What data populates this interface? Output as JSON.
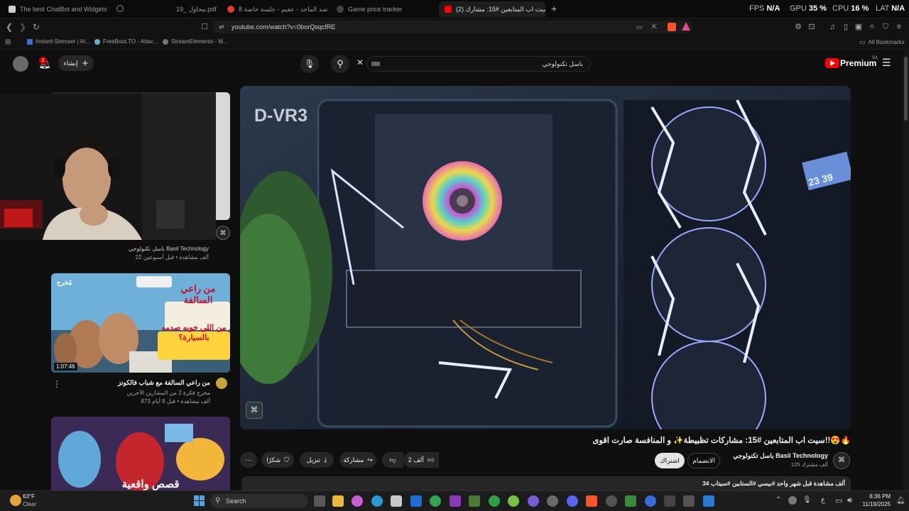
{
  "tabs": [
    {
      "label": "The best ChatBot and Widgets for K",
      "color": "#cfcfcf"
    },
    {
      "label": "19_ محاول.pdf",
      "color": "#8e8e8e"
    },
    {
      "label": "راشد الماجد - عقيم - جلسة خاصة 8",
      "color": "#e53935"
    },
    {
      "label": "Game price tracker",
      "color": "#444444"
    },
    {
      "label": "(2) سيت اب المتابعين #15: مشارك",
      "color": "#ff0000"
    }
  ],
  "stats": {
    "fps_label": "FPS",
    "fps": "N/A",
    "gpu_label": "GPU",
    "gpu": "35 %",
    "cpu_label": "CPU",
    "cpu": "16 %",
    "lat_label": "LAT",
    "lat": "N/A"
  },
  "url": "youtube.com/watch?v=0borQsqcfRE",
  "bookmarks": [
    {
      "label": "Instant-Stresser | At..."
    },
    {
      "label": "FreeBoot.TO - Attac..."
    },
    {
      "label": "StreamElements - M..."
    }
  ],
  "all_bookmarks": "All Bookmarks",
  "youtube": {
    "create_label": "إنشاء",
    "notif_count": "2",
    "search_value": "باسل تكنولوجي",
    "logo": "Premium",
    "logo_sup": "SA"
  },
  "player": {
    "overlay_text": "D-VR3",
    "display_digits": "23 39"
  },
  "video": {
    "title": "سيت اب المتابعين #15: مشاركات تظبيطة✨ و المنافسة صارت اقوى!!😍🔥",
    "channel": "باسل تكنولوجي Basil Technology",
    "subs": "125 ألف مشترك",
    "join": "الانضمام",
    "subscribe": "اشتراك",
    "likes": "2 ألف",
    "share": "مشاركة",
    "download": "تنزيل",
    "thanks": "شكرًا",
    "desc_line": "34 ألف مشاهدة قبل شهر واحد #بيسي #الستابين #سيتاب"
  },
  "recs": [
    {
      "channel": "باسل تكنولوجي Basil Technology",
      "meta": "22 ألف مشاهدة • قبل أسبوعين"
    },
    {
      "title": "من راعي السالفة مع شباب فالكونز",
      "channel": "مخرج فكرة 2 من المشارين الآخرين",
      "meta": "873 ألف مشاهدة • قبل 8 أيام",
      "duration": "1:07:46",
      "thumb_text": "من راعي السالفة",
      "thumb_sub": "من اللي خويه صدمه بالسيارة؟",
      "brand": "مُخرج"
    },
    {
      "thumb_text": "قصص واقعية"
    }
  ],
  "taskbar": {
    "weather_temp": "63°F",
    "weather_desc": "Clear",
    "search_label": "Search",
    "time": "6:36 PM",
    "date": "11/19/2025"
  }
}
